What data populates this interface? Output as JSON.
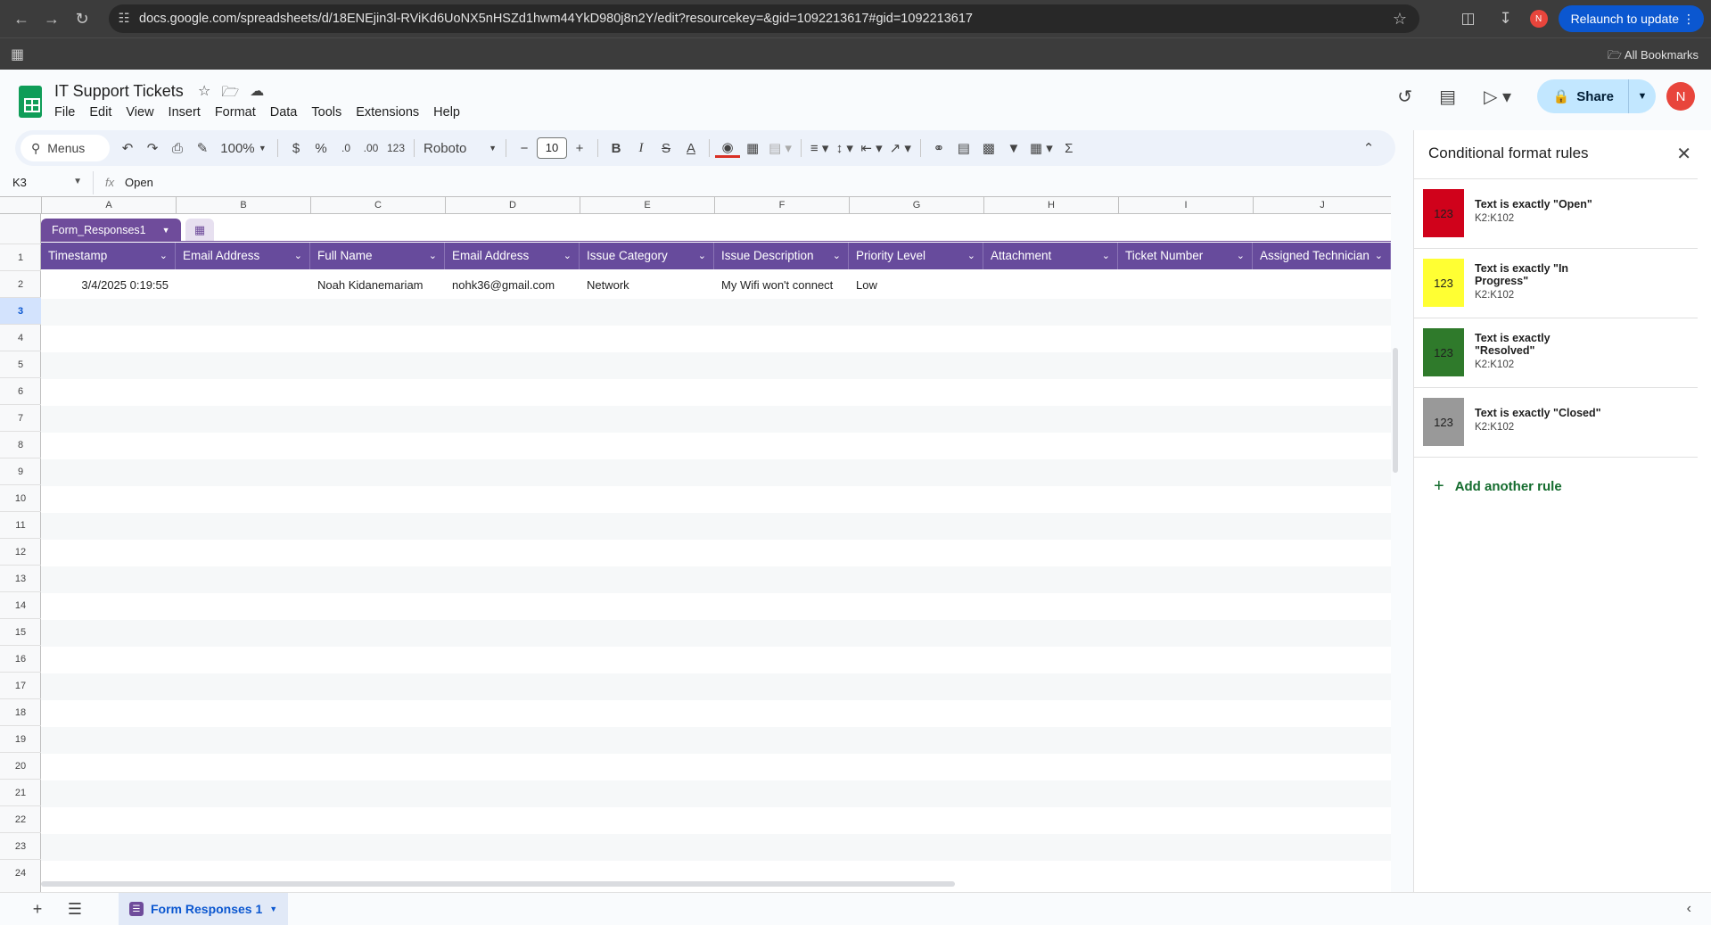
{
  "browser": {
    "url": "docs.google.com/spreadsheets/d/18ENEjin3l-RViKd6UoNX5nHSZd1hwm44YkD980j8n2Y/edit?resourcekey=&gid=1092213617#gid=1092213617",
    "profile_initial": "N",
    "relaunch_label": "Relaunch to update",
    "bookmarks_label": "All Bookmarks"
  },
  "doc": {
    "title": "IT Support Tickets",
    "menus": [
      "File",
      "Edit",
      "View",
      "Insert",
      "Format",
      "Data",
      "Tools",
      "Extensions",
      "Help"
    ],
    "share_label": "Share",
    "avatar_initial": "N"
  },
  "toolbar": {
    "search_label": "Menus",
    "zoom": "100%",
    "currency": "$",
    "percent": "%",
    "dec_decrease": ".0",
    "dec_increase": ".00",
    "number_format": "123",
    "font": "Roboto",
    "font_size": "10",
    "bold": "B",
    "italic": "I",
    "strike": "S",
    "text_color": "A"
  },
  "formula_bar": {
    "cell_ref": "K3",
    "fx": "fx",
    "value": "Open"
  },
  "grid": {
    "columns": [
      "A",
      "B",
      "C",
      "D",
      "E",
      "F",
      "G",
      "H",
      "I",
      "J"
    ],
    "table_name": "Form_Responses1",
    "headers": [
      "Timestamp",
      "Email Address",
      "Full Name",
      "Email Address",
      "Issue Category",
      "Issue Description",
      "Priority Level",
      "Attachment",
      "Ticket Number",
      "Assigned Technician"
    ],
    "rows": [
      [
        "3/4/2025 0:19:55",
        "",
        "Noah Kidanemariam",
        "nohk36@gmail.com",
        "Network",
        "My Wifi won't connect",
        "Low",
        "",
        "",
        ""
      ]
    ],
    "row_numbers": [
      "1",
      "2",
      "3",
      "4",
      "5",
      "6",
      "7",
      "8",
      "9",
      "10",
      "11",
      "12",
      "13",
      "14",
      "15",
      "16",
      "17",
      "18",
      "19",
      "20",
      "21",
      "22",
      "23",
      "24"
    ],
    "selected_row": "3"
  },
  "sheet_tabs": [
    {
      "label": "Form Responses 1"
    }
  ],
  "panel": {
    "title": "Conditional format rules",
    "rules": [
      {
        "preview": "123",
        "color": "#d0021b",
        "text": "Text is exactly \"Open\"",
        "range": "K2:K102"
      },
      {
        "preview": "123",
        "color": "#ffff33",
        "text": "Text is exactly \"In Progress\"",
        "range": "K2:K102"
      },
      {
        "preview": "123",
        "color": "#2f7a2b",
        "text": "Text is exactly \"Resolved\"",
        "range": "K2:K102"
      },
      {
        "preview": "123",
        "color": "#999999",
        "text": "Text is exactly \"Closed\"",
        "range": "K2:K102"
      }
    ],
    "add_label": "Add another rule"
  }
}
